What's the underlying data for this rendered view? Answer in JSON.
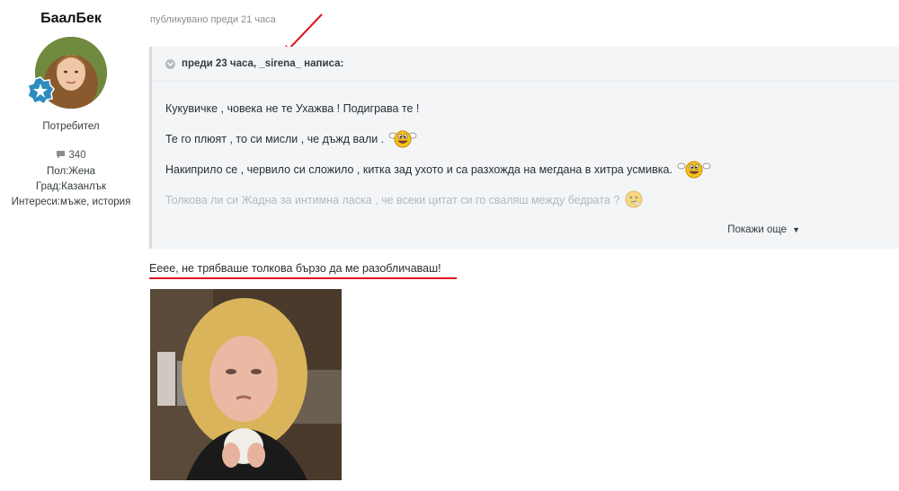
{
  "author": {
    "name": "БаалБек",
    "role": "Потребител",
    "posts": "340",
    "gender": "Пол:Жена",
    "city": "Град:Казанлък",
    "interests": "Интереси:мъже, история"
  },
  "post": {
    "published": "публикувано преди 21 часа",
    "quote": {
      "header": "преди 23 часа, _sirena_ написа:",
      "lines": [
        "Кукувичке , човека не те Ухажва ! Подиграва те !",
        "Те го плюят , то си мисли , че дъжд вали .",
        "Накиприло се , червило си сложило , китка зад ухото и са разхожда на мегдана в хитра усмивка.",
        "Толкова ли си Жадна за интимна ласка , че всеки цитат си го сваляш между бедрата ?"
      ],
      "show_more": "Покажи още"
    },
    "reply_text": "Ееее, не трябваше толкова бързо да ме разобличаваш!"
  },
  "colors": {
    "annotation_red": "#e0141b",
    "badge_blue": "#2e8bc0",
    "quote_bg": "#f3f5f7"
  },
  "icons": {
    "posts": "comment-icon",
    "badge": "star-badge-icon",
    "collapse": "chevron-down-icon",
    "more": "caret-down-icon"
  }
}
